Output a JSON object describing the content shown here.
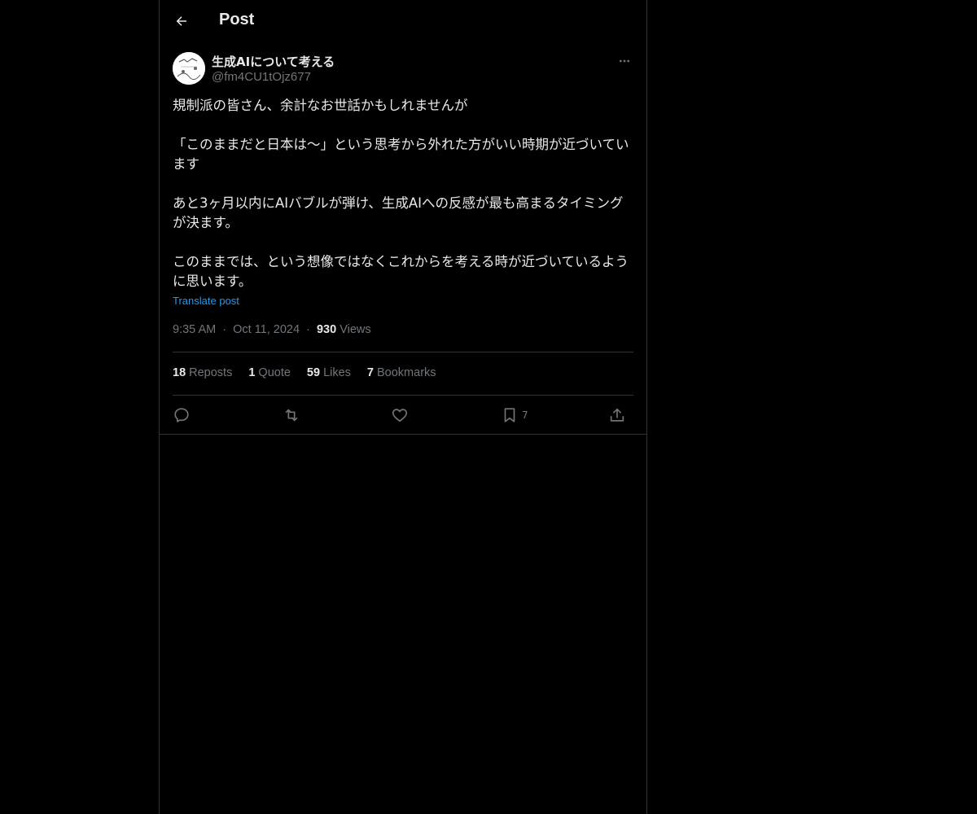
{
  "header": {
    "title": "Post",
    "back_icon": "arrow-left-icon"
  },
  "author": {
    "name": "生成AIについて考える",
    "handle": "@fm4CU1tOjz677",
    "avatar_icon": "avatar-image",
    "more_icon": "more-horizontal-icon"
  },
  "post": {
    "paragraphs": [
      "規制派の皆さん、余計なお世話かもしれませんが",
      "「このままだと日本は〜」という思考から外れた方がいい時期が近づいています",
      "あと3ヶ月以内にAIバブルが弾け、生成AIへの反感が最も高まるタイミングが決ます。",
      "このままでは、という想像ではなくこれからを考える時が近づいているように思います。"
    ],
    "translate_label": "Translate post",
    "time": "9:35 AM",
    "separator": "·",
    "date": "Oct 11, 2024",
    "views_count": "930",
    "views_label": "Views"
  },
  "stats": {
    "reposts_count": "18",
    "reposts_label": "Reposts",
    "quotes_count": "1",
    "quotes_label": "Quote",
    "likes_count": "59",
    "likes_label": "Likes",
    "bookmarks_count": "7",
    "bookmarks_label": "Bookmarks"
  },
  "actions": {
    "reply_icon": "reply-icon",
    "repost_icon": "repost-icon",
    "like_icon": "heart-icon",
    "bookmark_icon": "bookmark-icon",
    "bookmark_count": "7",
    "share_icon": "share-icon"
  },
  "colors": {
    "background": "#000000",
    "text": "#e7e9ea",
    "secondary": "#71767b",
    "link": "#1d9bf0",
    "border": "#2f3336"
  }
}
